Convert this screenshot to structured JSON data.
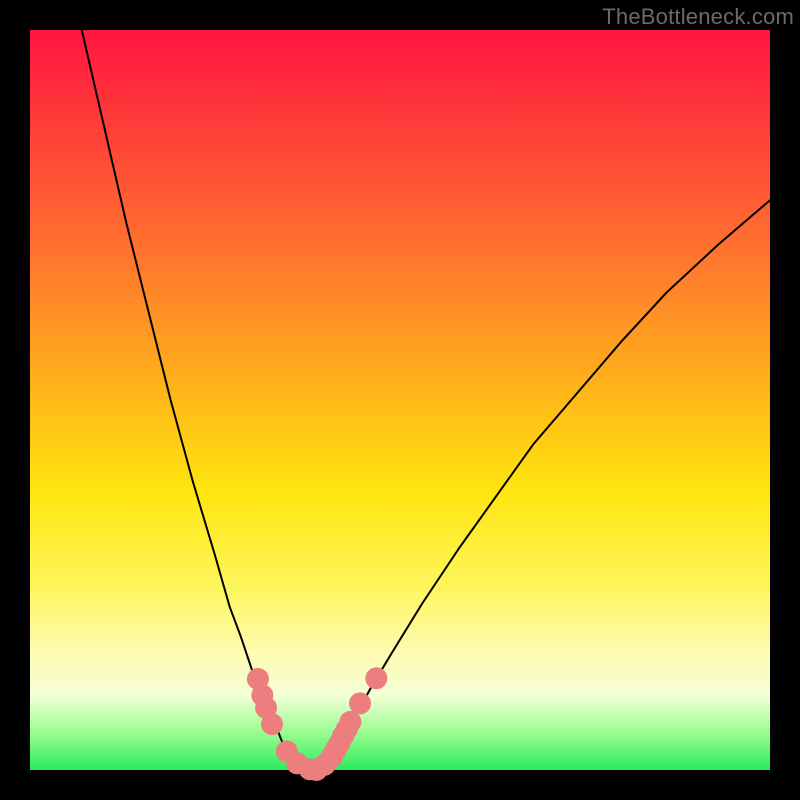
{
  "watermark": "TheBottleneck.com",
  "chart_data": {
    "type": "line",
    "title": "",
    "xlabel": "",
    "ylabel": "",
    "xlim": [
      0,
      100
    ],
    "ylim": [
      0,
      100
    ],
    "grid": false,
    "legend": false,
    "background_gradient_stops": [
      {
        "pos": 0.0,
        "color": "#ff163f"
      },
      {
        "pos": 0.15,
        "color": "#ff4338"
      },
      {
        "pos": 0.32,
        "color": "#ff7a2c"
      },
      {
        "pos": 0.48,
        "color": "#ffb21a"
      },
      {
        "pos": 0.62,
        "color": "#ffe40e"
      },
      {
        "pos": 0.75,
        "color": "#fdf659"
      },
      {
        "pos": 0.84,
        "color": "#fffbb0"
      },
      {
        "pos": 0.9,
        "color": "#f3ffd6"
      },
      {
        "pos": 0.95,
        "color": "#98fd8f"
      },
      {
        "pos": 1.0,
        "color": "#2beb5d"
      }
    ],
    "series": [
      {
        "name": "left-branch",
        "stroke": "#000000",
        "stroke_width": 2,
        "x": [
          7,
          10,
          13,
          16,
          19,
          22,
          25,
          27,
          28.5,
          30,
          31.5,
          33,
          34,
          34.7,
          35.3
        ],
        "y": [
          100,
          87,
          74,
          62,
          50,
          39,
          29,
          22,
          18,
          13.5,
          10,
          6.5,
          4,
          2.5,
          1.3
        ]
      },
      {
        "name": "right-branch",
        "stroke": "#000000",
        "stroke_width": 2,
        "x": [
          40.5,
          41.3,
          42.5,
          44,
          46,
          49,
          53,
          58,
          63,
          68,
          74,
          80,
          86,
          93,
          100
        ],
        "y": [
          1.3,
          2.6,
          4.6,
          7.3,
          11,
          16,
          22.5,
          30,
          37,
          44,
          51,
          58,
          64.5,
          71,
          77
        ]
      },
      {
        "name": "valley-floor",
        "stroke": "#000000",
        "stroke_width": 2,
        "x": [
          35.3,
          36.2,
          37.1,
          38.0,
          38.9,
          39.7,
          40.5
        ],
        "y": [
          1.3,
          0.6,
          0.2,
          0.0,
          0.2,
          0.6,
          1.3
        ]
      }
    ],
    "annotations": [
      {
        "name": "pink-dots",
        "shape": "circle",
        "fill": "#ed7e80",
        "radius": 11,
        "points": [
          {
            "x": 30.8,
            "y": 12.3
          },
          {
            "x": 31.4,
            "y": 10.1
          },
          {
            "x": 31.9,
            "y": 8.4
          },
          {
            "x": 32.7,
            "y": 6.2
          },
          {
            "x": 34.7,
            "y": 2.5
          },
          {
            "x": 36.1,
            "y": 0.9
          },
          {
            "x": 37.8,
            "y": 0.1
          },
          {
            "x": 38.7,
            "y": 0.0
          },
          {
            "x": 39.8,
            "y": 0.7
          },
          {
            "x": 40.8,
            "y": 1.8
          },
          {
            "x": 41.3,
            "y": 2.7
          },
          {
            "x": 41.8,
            "y": 3.6
          },
          {
            "x": 42.3,
            "y": 4.6
          },
          {
            "x": 42.8,
            "y": 5.5
          },
          {
            "x": 43.3,
            "y": 6.5
          },
          {
            "x": 44.6,
            "y": 9.0
          },
          {
            "x": 46.8,
            "y": 12.4
          }
        ]
      }
    ]
  }
}
